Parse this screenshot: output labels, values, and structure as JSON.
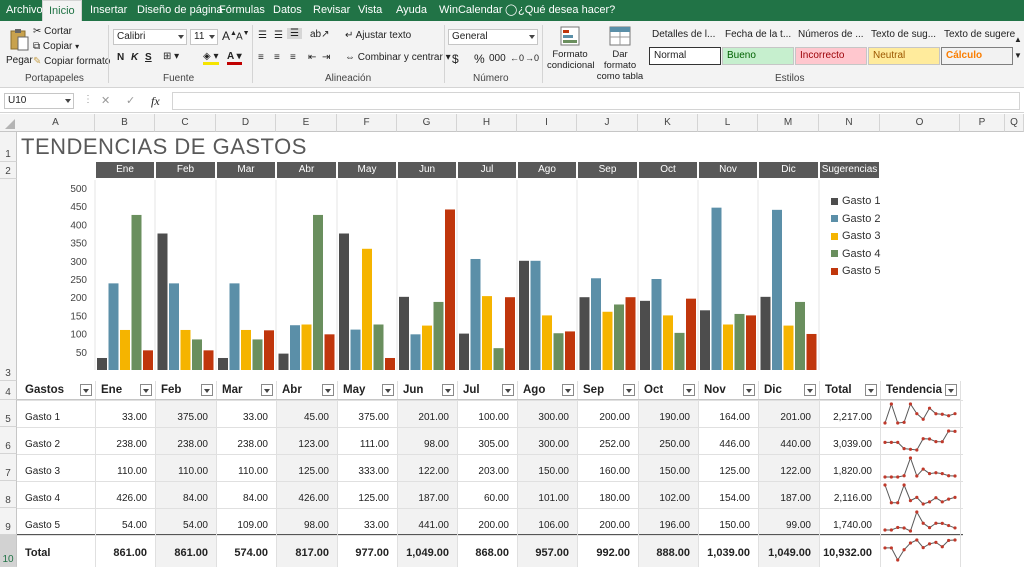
{
  "ribbon": {
    "tabs": [
      "Archivo",
      "Inicio",
      "Insertar",
      "Diseño de página",
      "Fórmulas",
      "Datos",
      "Revisar",
      "Vista",
      "Ayuda",
      "WinCalendar"
    ],
    "active_tab": "Inicio",
    "search_placeholder": "¿Qué desea hacer?",
    "clipboard": {
      "paste": "Pegar",
      "cut": "Cortar",
      "copy": "Copiar",
      "format_painter": "Copiar formato",
      "label": "Portapapeles"
    },
    "font": {
      "name": "Calibri",
      "size": "11",
      "bold": "N",
      "italic": "K",
      "underline": "S",
      "label": "Fuente"
    },
    "alignment": {
      "wrap_text": "Ajustar texto",
      "merge_center": "Combinar y centrar",
      "label": "Alineación"
    },
    "number": {
      "format": "General",
      "currency": "$",
      "percent": "%",
      "thousands": "000",
      "label": "Número"
    },
    "styles": {
      "conditional_format": "Formato condicional",
      "format_as_table": "Dar formato como tabla",
      "heads": [
        "Detalles de l...",
        "Fecha de la t...",
        "Números de ...",
        "Texto de sug...",
        "Texto de sugere..."
      ],
      "cells": [
        "Normal",
        "Bueno",
        "Incorrecto",
        "Neutral",
        "Cálculo"
      ],
      "label": "Estilos"
    }
  },
  "formula_bar": {
    "name_box": "U10",
    "cancel": "✕",
    "enter": "✓",
    "fx": "fx",
    "content": ""
  },
  "columns": [
    "A",
    "B",
    "C",
    "D",
    "E",
    "F",
    "G",
    "H",
    "I",
    "J",
    "K",
    "L",
    "M",
    "N",
    "O",
    "P",
    "Q"
  ],
  "rows": [
    "1",
    "2",
    "3",
    "4",
    "5",
    "6",
    "7",
    "8",
    "9",
    "10"
  ],
  "sheet": {
    "title": "TENDENCIAS DE GASTOS",
    "month_headers": [
      "Ene",
      "Feb",
      "Mar",
      "Abr",
      "May",
      "Jun",
      "Jul",
      "Ago",
      "Sep",
      "Oct",
      "Nov",
      "Dic",
      "Sugerencias"
    ],
    "table_headers": [
      "Gastos",
      "Ene",
      "Feb",
      "Mar",
      "Abr",
      "May",
      "Jun",
      "Jul",
      "Ago",
      "Sep",
      "Oct",
      "Nov",
      "Dic",
      "Total",
      "Tendencia"
    ],
    "table_rows": [
      {
        "name": "Gasto 1",
        "values": [
          "33.00",
          "375.00",
          "33.00",
          "45.00",
          "375.00",
          "201.00",
          "100.00",
          "300.00",
          "200.00",
          "190.00",
          "164.00",
          "201.00"
        ],
        "total": "2,217.00"
      },
      {
        "name": "Gasto 2",
        "values": [
          "238.00",
          "238.00",
          "238.00",
          "123.00",
          "111.00",
          "98.00",
          "305.00",
          "300.00",
          "252.00",
          "250.00",
          "446.00",
          "440.00"
        ],
        "total": "3,039.00"
      },
      {
        "name": "Gasto 3",
        "values": [
          "110.00",
          "110.00",
          "110.00",
          "125.00",
          "333.00",
          "122.00",
          "203.00",
          "150.00",
          "160.00",
          "150.00",
          "125.00",
          "122.00"
        ],
        "total": "1,820.00"
      },
      {
        "name": "Gasto 4",
        "values": [
          "426.00",
          "84.00",
          "84.00",
          "426.00",
          "125.00",
          "187.00",
          "60.00",
          "101.00",
          "180.00",
          "102.00",
          "154.00",
          "187.00"
        ],
        "total": "2,116.00"
      },
      {
        "name": "Gasto 5",
        "values": [
          "54.00",
          "54.00",
          "109.00",
          "98.00",
          "33.00",
          "441.00",
          "200.00",
          "106.00",
          "200.00",
          "196.00",
          "150.00",
          "99.00"
        ],
        "total": "1,740.00"
      }
    ],
    "total_row": {
      "name": "Total",
      "values": [
        "861.00",
        "861.00",
        "574.00",
        "817.00",
        "977.00",
        "1,049.00",
        "868.00",
        "957.00",
        "992.00",
        "888.00",
        "1,039.00",
        "1,049.00"
      ],
      "total": "10,932.00"
    }
  },
  "colors": {
    "accent": "#217346",
    "header_dark": "#595959",
    "sparkline": "#595959",
    "sparkline_marker": "#c0392b"
  },
  "chart_data": {
    "type": "bar",
    "categories": [
      "Ene",
      "Feb",
      "Mar",
      "Abr",
      "May",
      "Jun",
      "Jul",
      "Ago",
      "Sep",
      "Oct",
      "Nov",
      "Dic"
    ],
    "series": [
      {
        "name": "Gasto 1",
        "color": "#4d4d4d",
        "values": [
          33,
          375,
          33,
          45,
          375,
          201,
          100,
          300,
          200,
          190,
          164,
          201
        ]
      },
      {
        "name": "Gasto 2",
        "color": "#5b8fa8",
        "values": [
          238,
          238,
          238,
          123,
          111,
          98,
          305,
          300,
          252,
          250,
          446,
          440
        ]
      },
      {
        "name": "Gasto 3",
        "color": "#f5b400",
        "values": [
          110,
          110,
          110,
          125,
          333,
          122,
          203,
          150,
          160,
          150,
          125,
          122
        ]
      },
      {
        "name": "Gasto 4",
        "color": "#6a8f5e",
        "values": [
          426,
          84,
          84,
          426,
          125,
          187,
          60,
          101,
          180,
          102,
          154,
          187
        ]
      },
      {
        "name": "Gasto 5",
        "color": "#c0360c",
        "values": [
          54,
          54,
          109,
          98,
          33,
          441,
          200,
          106,
          200,
          196,
          150,
          99
        ]
      }
    ],
    "yticks": [
      50,
      100,
      150,
      200,
      250,
      300,
      350,
      400,
      450,
      500
    ],
    "ylim": [
      0,
      500
    ],
    "grid": "vertical separators",
    "legend": "right"
  }
}
